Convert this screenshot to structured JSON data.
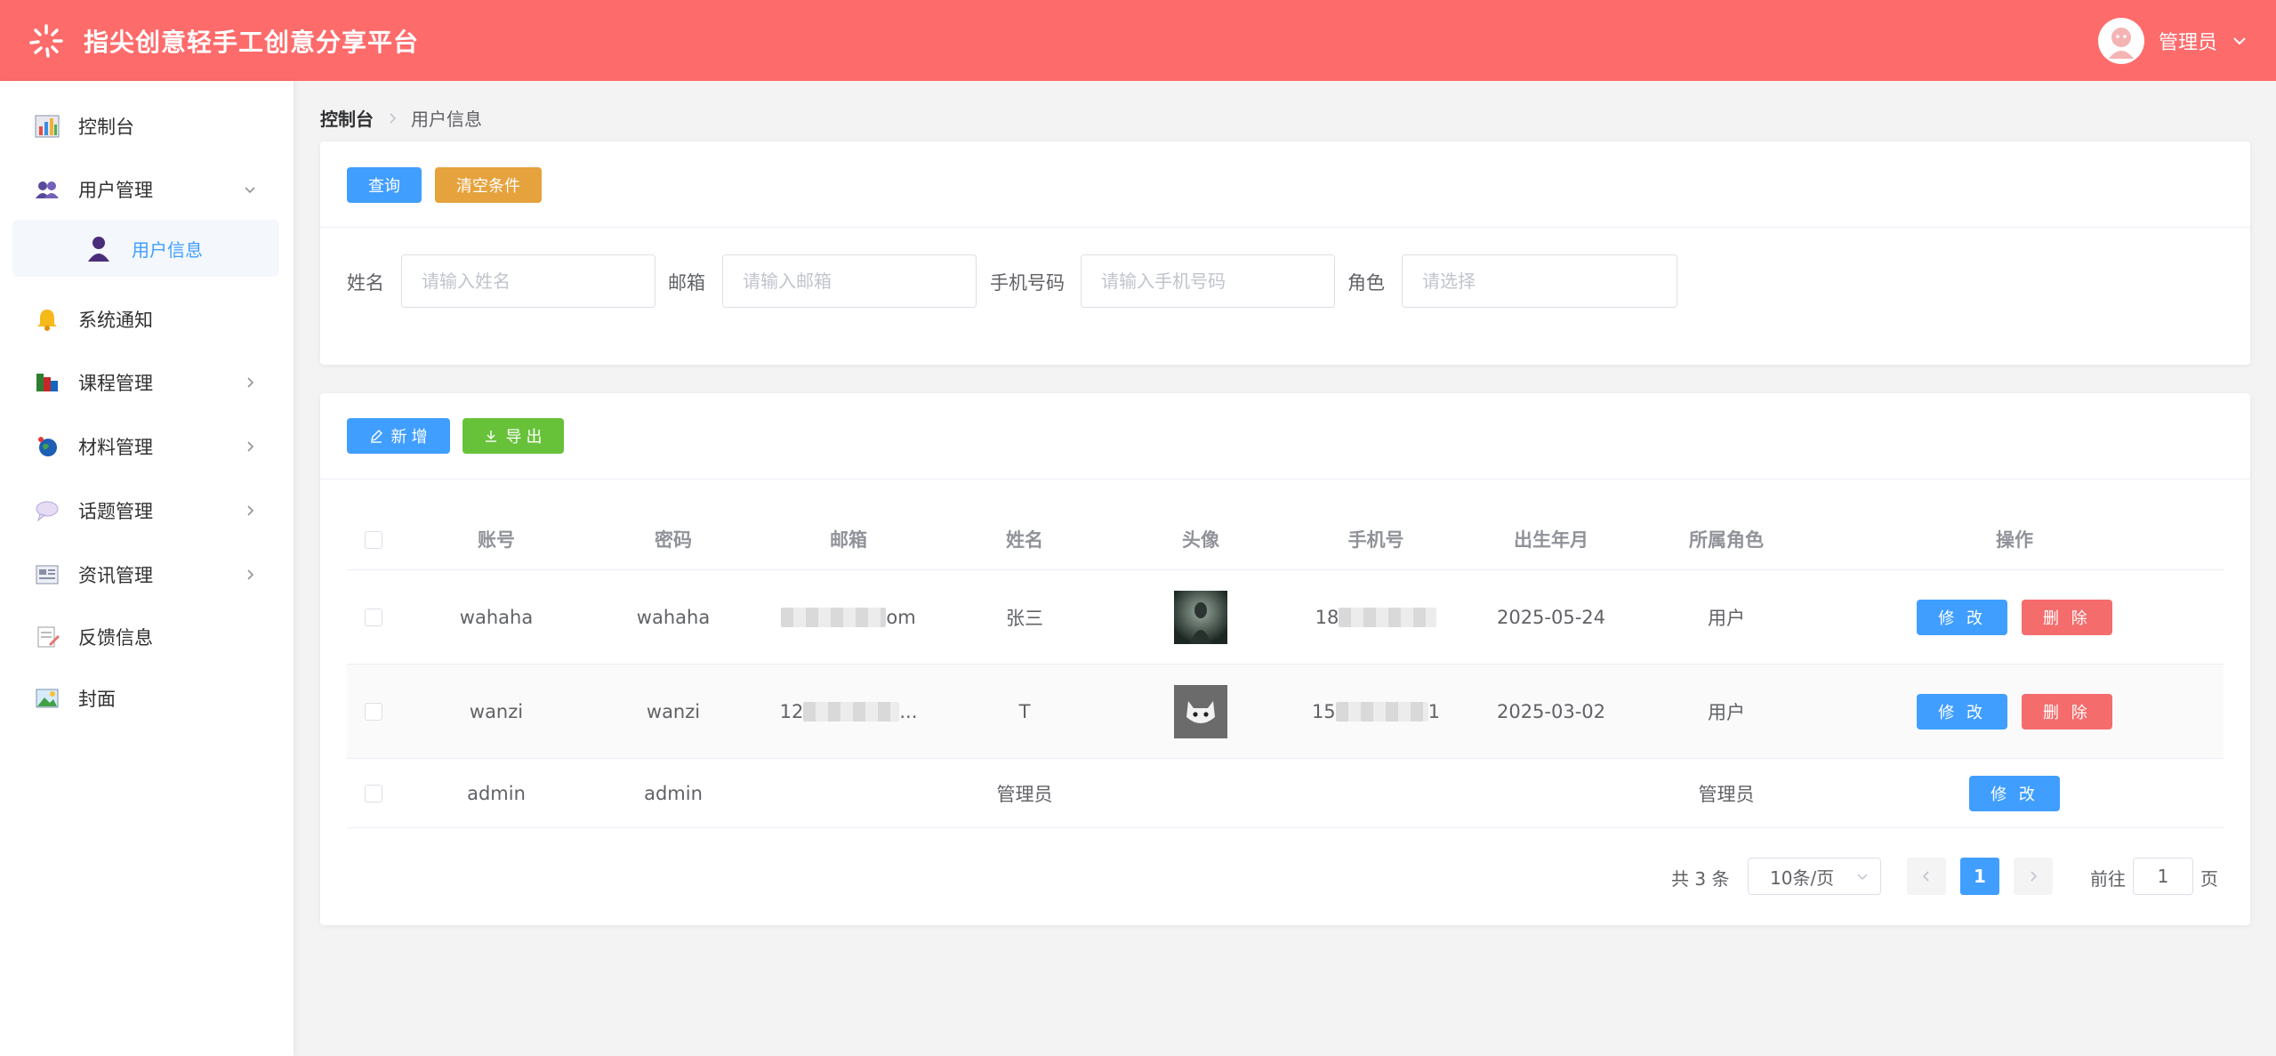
{
  "header": {
    "title": "指尖创意轻手工创意分享平台",
    "user_name": "管理员",
    "brand_color": "#fe6b6b"
  },
  "sidebar": {
    "items": [
      {
        "label": "控制台",
        "icon": "chart-icon"
      },
      {
        "label": "用户管理",
        "icon": "users-icon",
        "expanded": true
      },
      {
        "label": "用户信息",
        "icon": "user-icon",
        "active": true
      },
      {
        "label": "系统通知",
        "icon": "bell-icon"
      },
      {
        "label": "课程管理",
        "icon": "books-icon"
      },
      {
        "label": "材料管理",
        "icon": "globe-icon"
      },
      {
        "label": "话题管理",
        "icon": "chat-bubble-icon"
      },
      {
        "label": "资讯管理",
        "icon": "news-icon"
      },
      {
        "label": "反馈信息",
        "icon": "feedback-icon"
      },
      {
        "label": "封面",
        "icon": "image-icon"
      }
    ]
  },
  "breadcrumb": {
    "root": "控制台",
    "current": "用户信息"
  },
  "search": {
    "query_label": "查询",
    "clear_label": "清空条件",
    "name_label": "姓名",
    "name_placeholder": "请输入姓名",
    "email_label": "邮箱",
    "email_placeholder": "请输入邮箱",
    "phone_label": "手机号码",
    "phone_placeholder": "请输入手机号码",
    "role_label": "角色",
    "role_placeholder": "请选择"
  },
  "toolbar": {
    "add_label": "新 增",
    "export_label": "导 出"
  },
  "table": {
    "columns": [
      "账号",
      "密码",
      "邮箱",
      "姓名",
      "头像",
      "手机号",
      "出生年月",
      "所属角色",
      "操作"
    ],
    "rows": [
      {
        "account": "wahaha",
        "password": "wahaha",
        "email_start": "",
        "email_end": "om",
        "name": "张三",
        "phone_start": "18",
        "phone_end": "",
        "birth": "2025-05-24",
        "role": "用户"
      },
      {
        "account": "wanzi",
        "password": "wanzi",
        "email_start": "12",
        "email_end": "...",
        "name": "T",
        "phone_start": "15",
        "phone_end": "1",
        "birth": "2025-03-02",
        "role": "用户"
      },
      {
        "account": "admin",
        "password": "admin",
        "email_start": "",
        "email_end": "",
        "name": "管理员",
        "phone_start": "",
        "phone_end": "",
        "birth": "",
        "role": "管理员"
      }
    ],
    "edit_label": "修 改",
    "delete_label": "删 除"
  },
  "pagination": {
    "total_text": "共 3 条",
    "page_size": "10条/页",
    "current_page": "1",
    "goto_label": "前往",
    "goto_value": "1",
    "page_suffix": "页"
  }
}
